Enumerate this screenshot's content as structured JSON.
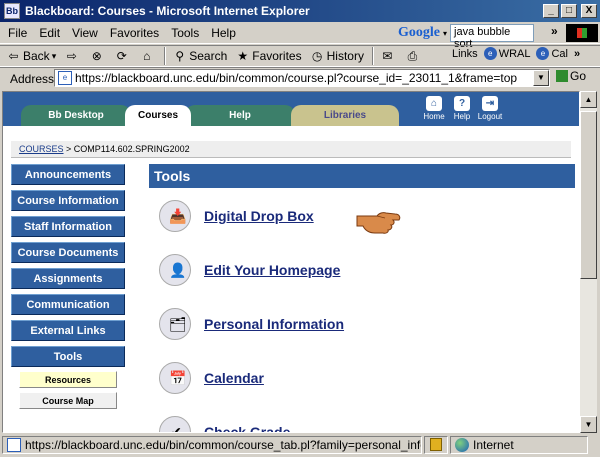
{
  "window": {
    "title": "Blackboard: Courses - Microsoft Internet Explorer",
    "minimize": "_",
    "maximize": "□",
    "close": "X"
  },
  "menu": {
    "items": [
      "File",
      "Edit",
      "View",
      "Favorites",
      "Tools",
      "Help"
    ]
  },
  "google": {
    "logo": "Google",
    "search_value": "java bubble sort"
  },
  "toolbar": {
    "back": "Back",
    "search": "Search",
    "favorites": "Favorites",
    "history": "History",
    "links_label": "Links",
    "link1": "WRAL",
    "link2": "Cal"
  },
  "address": {
    "label": "Address",
    "url": "https://blackboard.unc.edu/bin/common/course.pl?course_id=_23011_1&frame=top",
    "go": "Go"
  },
  "bb_tabs": [
    "Bb Desktop",
    "Courses",
    "Help",
    "Libraries"
  ],
  "header_icons": [
    "Home",
    "Help",
    "Logout"
  ],
  "breadcrumb": {
    "link": "COURSES",
    "current": " > COMP114.602.SPRING2002"
  },
  "nav": {
    "buttons": [
      "Announcements",
      "Course Information",
      "Staff Information",
      "Course Documents",
      "Assignments",
      "Communication",
      "External Links",
      "Tools"
    ],
    "sub": [
      "Resources",
      "Course Map"
    ]
  },
  "tools": {
    "title": "Tools",
    "items": [
      "Digital Drop Box",
      "Edit Your Homepage",
      "Personal Information",
      "Calendar",
      "Check Grade"
    ]
  },
  "status": {
    "url": "https://blackboard.unc.edu/bin/common/course_tab.pl?family=personal_info&c",
    "zone": "Internet"
  }
}
